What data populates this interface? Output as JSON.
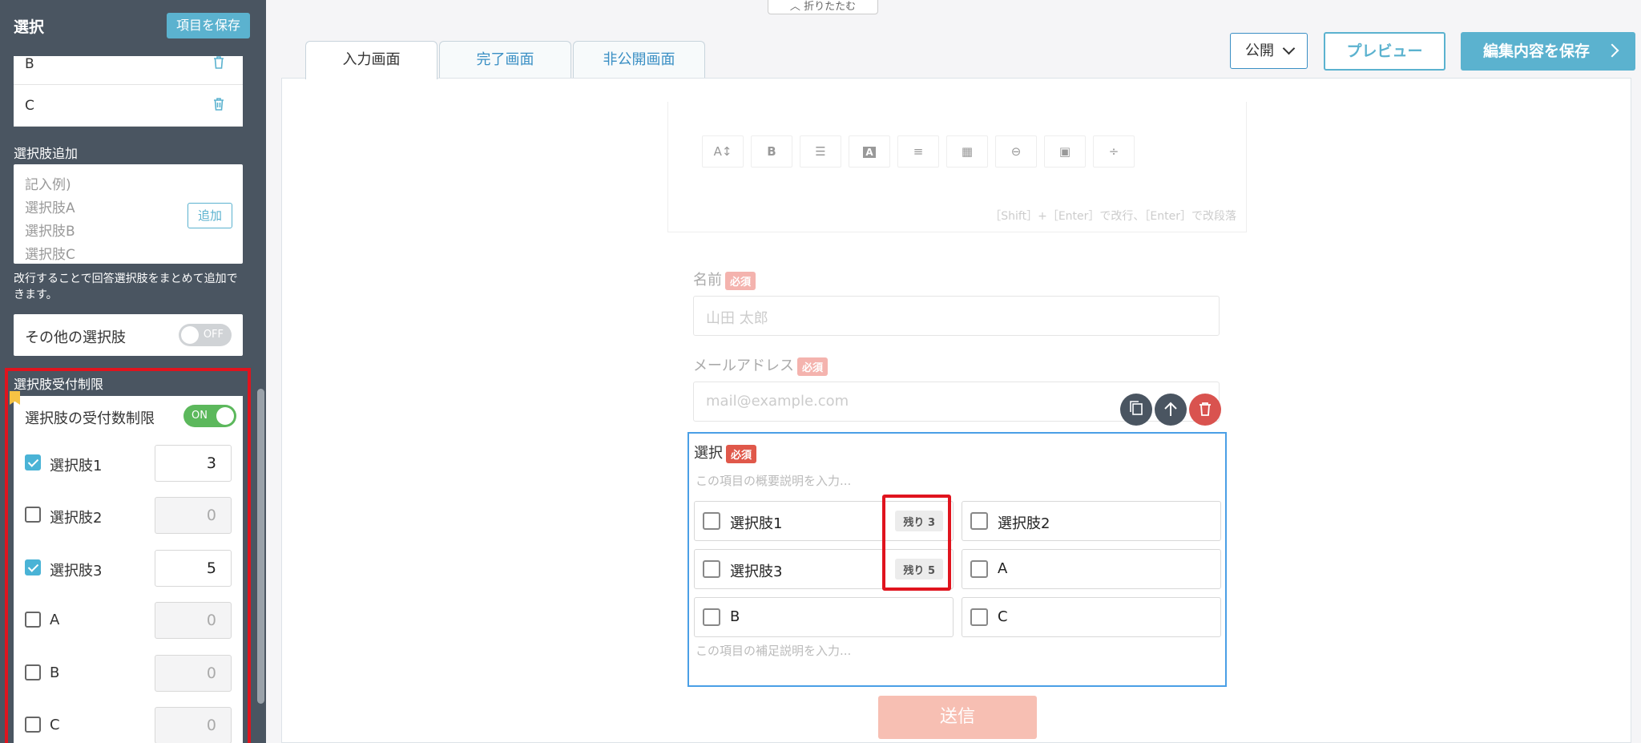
{
  "sidebar": {
    "title": "選択",
    "save_label": "項目を保存",
    "options": [
      "B",
      "C"
    ],
    "add_section_label": "選択肢追加",
    "textarea_placeholder": "記入例)\n選択肢A\n選択肢B\n選択肢C",
    "add_button": "追加",
    "note": "改行することで回答選択肢をまとめて追加できます。",
    "other_option_label": "その他の選択肢",
    "other_toggle": "OFF",
    "limit_section_title": "選択肢受付制限",
    "limit_toggle_label": "選択肢の受付数制限",
    "limit_toggle": "ON",
    "limit_rows": [
      {
        "name": "選択肢1",
        "checked": true,
        "value": "3"
      },
      {
        "name": "選択肢2",
        "checked": false,
        "value": "0"
      },
      {
        "name": "選択肢3",
        "checked": true,
        "value": "5"
      },
      {
        "name": "A",
        "checked": false,
        "value": "0"
      },
      {
        "name": "B",
        "checked": false,
        "value": "0"
      },
      {
        "name": "C",
        "checked": false,
        "value": "0"
      }
    ]
  },
  "topbar": {
    "collapse_label": "折りたたむ",
    "tabs": [
      "入力画面",
      "完了画面",
      "非公開画面"
    ],
    "publish_select": "公開",
    "preview_button": "プレビュー",
    "save_edit_button": "編集内容を保存"
  },
  "editor": {
    "hint": "［Shift］+［Enter］で改行、［Enter］で改段落",
    "toolbar": [
      "font-size-icon",
      "bold-icon",
      "list-icon",
      "text-color-icon",
      "align-icon",
      "table-icon",
      "link-icon",
      "image-icon",
      "divider-icon"
    ]
  },
  "form": {
    "name_label": "名前",
    "name_placeholder": "山田 太郎",
    "email_label": "メールアドレス",
    "email_placeholder": "mail@example.com",
    "required": "必須",
    "select_title": "選択",
    "select_desc_placeholder": "この項目の概要説明を入力...",
    "select_note_placeholder": "この項目の補足説明を入力...",
    "choices": [
      {
        "label": "選択肢1",
        "remain": "残り 3"
      },
      {
        "label": "選択肢2",
        "remain": ""
      },
      {
        "label": "選択肢3",
        "remain": "残り 5"
      },
      {
        "label": "A",
        "remain": ""
      },
      {
        "label": "B",
        "remain": ""
      },
      {
        "label": "C",
        "remain": ""
      }
    ],
    "submit": "送信"
  },
  "colors": {
    "accent": "#5bb2cf",
    "sidebar_bg": "#4a5561",
    "highlight": "#e0141e"
  }
}
